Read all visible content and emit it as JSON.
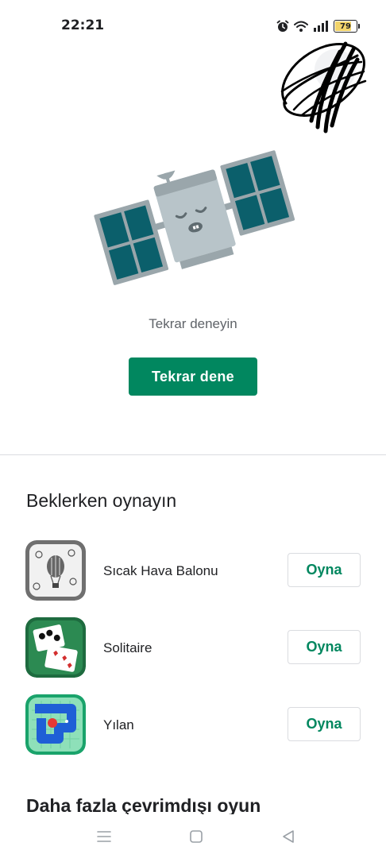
{
  "status_bar": {
    "time": "22:21",
    "battery_level": 79,
    "battery_label": "79",
    "icons": [
      "alarm-icon",
      "wifi-icon",
      "signal-icon",
      "battery-icon"
    ]
  },
  "error_state": {
    "illustration": "sleeping-satellite-illustration",
    "message": "Tekrar deneyin",
    "retry_label": "Tekrar dene"
  },
  "games_section": {
    "title": "Beklerken oynayın",
    "items": [
      {
        "name": "Sıcak Hava Balonu",
        "play_label": "Oyna",
        "icon": "hot-air-balloon-icon"
      },
      {
        "name": "Solitaire",
        "play_label": "Oyna",
        "icon": "solitaire-cards-icon"
      },
      {
        "name": "Yılan",
        "play_label": "Oyna",
        "icon": "snake-game-icon"
      }
    ]
  },
  "more_section": {
    "title": "Daha fazla çevrimdışı oyun"
  },
  "nav_bar": {
    "items": [
      "menu-icon",
      "home-icon",
      "back-icon"
    ]
  },
  "colors": {
    "accent": "#01875f",
    "satellite_panel": "#0b5f6b",
    "satellite_frame": "#9aa6ab",
    "satellite_body": "#b8c4c9",
    "divider": "#dadce0"
  }
}
